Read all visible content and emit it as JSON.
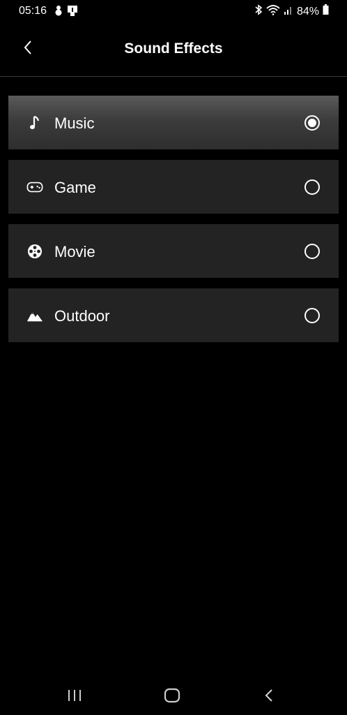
{
  "status_bar": {
    "time": "05:16",
    "battery": "84%",
    "icons_left": [
      "snowman-icon",
      "app-notification-icon"
    ],
    "icons_right": [
      "bluetooth-icon",
      "wifi-icon",
      "signal-icon",
      "battery-icon"
    ]
  },
  "header": {
    "title": "Sound Effects",
    "back_icon": "chevron-left-icon"
  },
  "options": [
    {
      "label": "Music",
      "icon": "music-note-icon",
      "selected": true
    },
    {
      "label": "Game",
      "icon": "gamepad-icon",
      "selected": false
    },
    {
      "label": "Movie",
      "icon": "film-reel-icon",
      "selected": false
    },
    {
      "label": "Outdoor",
      "icon": "mountain-icon",
      "selected": false
    }
  ],
  "nav_bar": {
    "buttons": [
      "recent-apps-icon",
      "home-icon",
      "back-icon"
    ]
  },
  "colors": {
    "background": "#000000",
    "option_background": "#232323",
    "selected_option_top": "#5a5a5a",
    "text": "#ffffff"
  }
}
